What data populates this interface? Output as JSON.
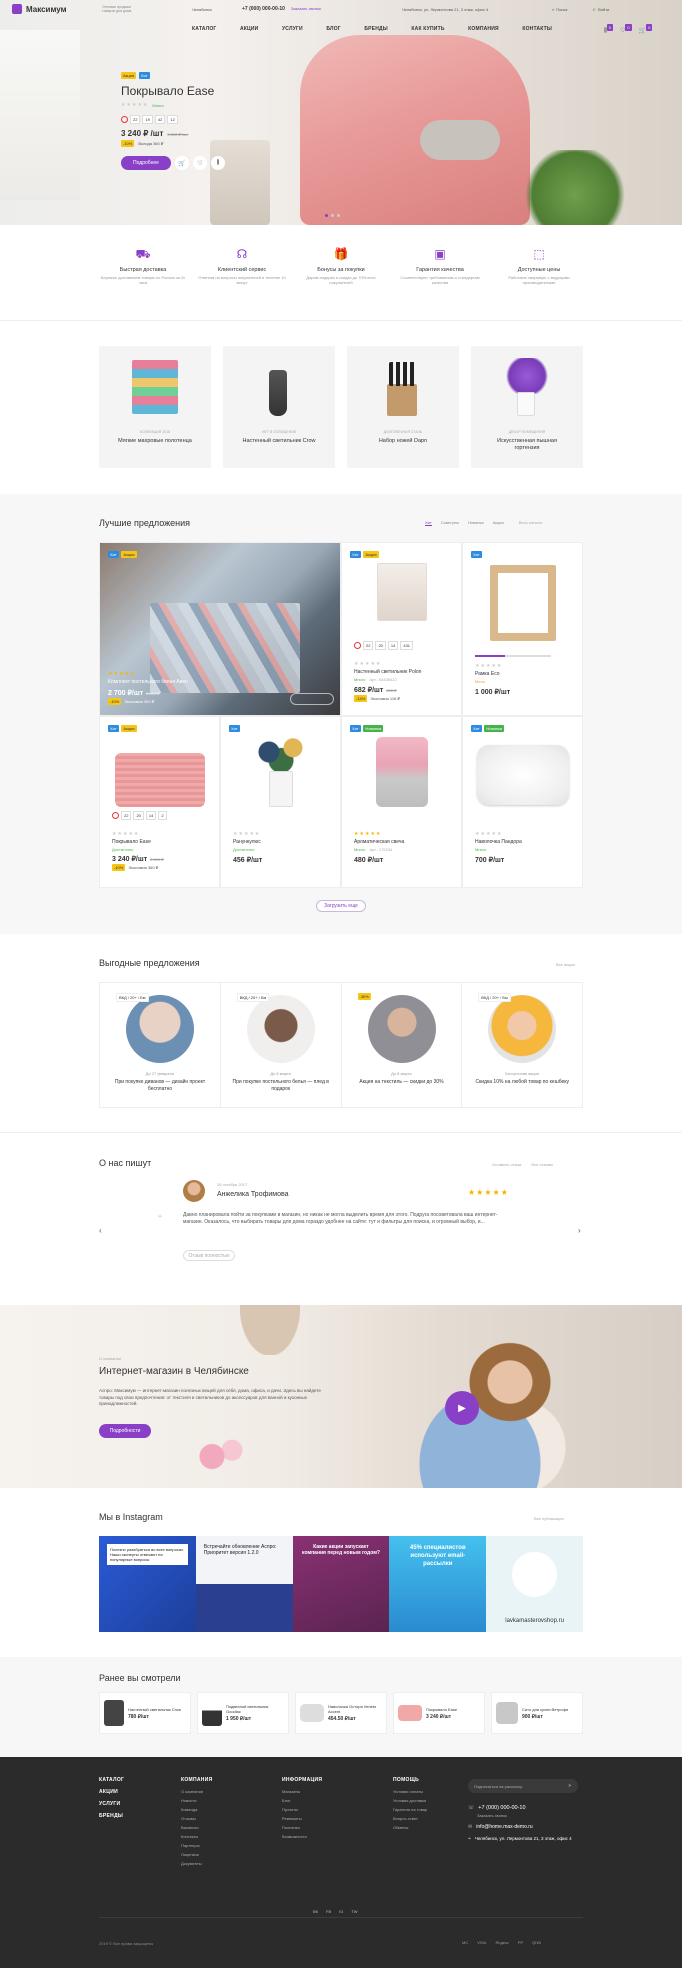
{
  "header": {
    "logo_text": "Максимум",
    "tagline_1": "Оптовая продажа",
    "tagline_2": "товаров для дома",
    "city": "Челябинск",
    "phone": "+7 (000) 000-00-10",
    "callback": "Заказать звонок",
    "address": "Челябинск, ул. Лермонтова 21, 3 этаж, офис 4",
    "search": "Поиск",
    "login": "Войти",
    "cart_count": "0",
    "fav_count": "0",
    "compare_count": "0",
    "nav": [
      "КАТАЛОГ",
      "АКЦИИ",
      "УСЛУГИ",
      "БЛОГ",
      "БРЕНДЫ",
      "КАК КУПИТЬ",
      "КОМПАНИЯ",
      "КОНТАКТЫ"
    ]
  },
  "hero": {
    "badges": [
      "Акция",
      "Хит"
    ],
    "title": "Покрывало Ease",
    "stock": "Много",
    "timer": [
      "22",
      "19",
      "42",
      "12"
    ],
    "price": "3 240 ₽ /шт",
    "old_price": "3 600 ₽ /шт",
    "discount": "-10%",
    "economy": "Выгода 360 ₽",
    "button": "Подробнее"
  },
  "benefits": [
    {
      "icon": "truck-icon",
      "title": "Быстрая доставка",
      "text": "Бережно доставляем товары по России за 2х часа"
    },
    {
      "icon": "headset-icon",
      "title": "Клиентский сервис",
      "text": "Ответим на вопросы покупателей в течение 10 минут"
    },
    {
      "icon": "gift-icon",
      "title": "Бонусы за покупки",
      "text": "Дарим подарки и скидки до 70% всех покупателей"
    },
    {
      "icon": "certificate-icon",
      "title": "Гарантия качества",
      "text": "Соответствуют требованиям и стандартам качества"
    },
    {
      "icon": "price-icon",
      "title": "Доступные цены",
      "text": "Работаем напрямую с ведущими производителями"
    }
  ],
  "categories": [
    {
      "caption": "Коллекция 2018",
      "title": "Мягкие махровые полотенца"
    },
    {
      "caption": "Нет в освещение",
      "title": "Настенный светильник Crow"
    },
    {
      "caption": "Долговечная сталь",
      "title": "Набор ножей Dapn"
    },
    {
      "caption": "Декор помещения",
      "title": "Искусственная пышная гортензия"
    }
  ],
  "best": {
    "title": "Лучшие предложения",
    "tabs": [
      "Хит",
      "Советуем",
      "Новинка",
      "Акция"
    ],
    "all_link": "Весь каталог",
    "load_more": "Загрузить еще",
    "products": [
      {
        "badges": [
          "Хит",
          "Акция"
        ],
        "name": "Комплект постельного белья Авен",
        "price": "2 700 ₽/шт",
        "old": "3 000 ₽",
        "discount": "-10%",
        "economy": "Экономия 300 ₽"
      },
      {
        "badges": [
          "Хит",
          "Акция"
        ],
        "name": "Настенный светильник Polon",
        "stock": "Много",
        "art": "Арт.: 54436422",
        "timer": [
          "22",
          "20",
          "14",
          "431"
        ],
        "price": "682 ₽/шт",
        "old": "800 ₽",
        "discount": "-14%",
        "economy": "Экономия 118 ₽"
      },
      {
        "badges": [
          "Хит"
        ],
        "name": "Рамка Eco",
        "stock": "Мало",
        "price": "1 000 ₽/шт"
      },
      {
        "badges": [
          "Хит",
          "Акция"
        ],
        "name": "Покрывало Ease",
        "stock": "Достаточно",
        "timer": [
          "22",
          "20",
          "14",
          "2"
        ],
        "price": "3 240 ₽/шт",
        "old": "3 600 ₽",
        "discount": "-10%",
        "economy": "Экономия 360 ₽"
      },
      {
        "badges": [
          "Хит"
        ],
        "name": "Ранункулюс",
        "stock": "Достаточно",
        "price": "456 ₽/шт"
      },
      {
        "badges": [
          "Хит",
          "Новинка"
        ],
        "name": "Ароматическая свеча",
        "stock": "Много",
        "art": "Арт.: 175234",
        "price": "480 ₽/шт"
      },
      {
        "badges": [
          "Хит",
          "Новинка"
        ],
        "name": "Наволочка Пандора",
        "stock": "Много",
        "price": "700 ₽/шт"
      }
    ]
  },
  "promos": {
    "title": "Выгодные предложения",
    "all_link": "Все акции",
    "items": [
      {
        "tag": "ВКД / 20+ / Бм",
        "date": "До 27 февраля",
        "text": "При покупке диванов — дизайн проект бесплатно"
      },
      {
        "tag": "ВКД / 20+ / Бм",
        "date": "До 8 марта",
        "text": "При покупке постельного белья — плед в подарок"
      },
      {
        "tag": "-30%",
        "date": "До 8 марта",
        "text": "Акция на текстиль — скидки до 30%"
      },
      {
        "tag": "ВКД / 20+ / Бм",
        "date": "Бессрочная акция",
        "text": "Скидка 10% на любой товар по кешбеку"
      }
    ]
  },
  "reviews": {
    "title": "О нас пишут",
    "leave": "Оставить отзыв",
    "all_link": "Все отзывы",
    "date": "26 октября 2017",
    "author": "Анжелика Трофимова",
    "text": "Давно планировала пойти за покупками в магазин, но никак не могла выделить время для этого. Подруга посоветовала ваш интернет-магазин. Оказалось, что выбирать товары для дома гораздо удобнее на сайте: тут и фильтры для поиска, и огромный выбор, и...",
    "more": "Отзыв полностью"
  },
  "about": {
    "label": "О компании",
    "title": "Интернет-магазин в Челябинске",
    "text": "Аспро: Максимум — интернет-магазин полезных вещей для себя, дома, офиса, и дачи. Здесь вы найдете товары под свои предпочтения: от текстиля и светильников до аксессуаров для ванной и кухонных принадлежностей.",
    "button": "Подробности"
  },
  "instagram": {
    "title": "Мы в Instagram",
    "all_link": "Все публикации",
    "posts": [
      {
        "text": "Полезно разобраться во всех вопросах. Наши эксперты отвечают на популярные вопросы",
        "color": "#2a5bd7"
      },
      {
        "text": "Встречайте обновление Аспро: Приоритет версия 1.2.0",
        "color": "#2a3f8f"
      },
      {
        "text": "Какие акции запускает компания перед новым годом?",
        "color": "#7a2e6e"
      },
      {
        "text": "45% специалистов используют email-рассылки",
        "color": "#3bb4e8"
      },
      {
        "text": "lavkamasterovshop.ru",
        "color": "#e9f4f7"
      }
    ]
  },
  "viewed": {
    "title": "Ранее вы смотрели",
    "items": [
      {
        "name": "Настенный светильник Crow",
        "price": "780 ₽/шт"
      },
      {
        "name": "Подвесной светильник Goodlac",
        "price": "1 950 ₽/шт"
      },
      {
        "name": "Наволочка Остора Veneto Accent",
        "price": "454.50 ₽/шт"
      },
      {
        "name": "Покрывало Ease",
        "price": "3 240 ₽/шт"
      },
      {
        "name": "Сито для кухни Ветрофи",
        "price": "900 ₽/шт"
      }
    ]
  },
  "footer": {
    "col1": [
      "КАТАЛОГ",
      "АКЦИИ",
      "УСЛУГИ",
      "БРЕНДЫ"
    ],
    "col2_title": "КОМПАНИЯ",
    "col2": [
      "О компании",
      "Новости",
      "Команда",
      "Отзывы",
      "Вакансии",
      "Контакты",
      "Партнеры",
      "Лицензии",
      "Документы"
    ],
    "col3_title": "ИНФОРМАЦИЯ",
    "col3": [
      "Магазины",
      "Блог",
      "Проекты",
      "Реквизиты",
      "Политика",
      "Возможности"
    ],
    "col4_title": "ПОМОЩЬ",
    "col4": [
      "Условия оплаты",
      "Условия доставки",
      "Гарантия на товар",
      "Вопрос-ответ",
      "Обмены"
    ],
    "subscribe": "Подписаться на рассылку",
    "phone": "+7 (000) 000-00-10",
    "callback": "Заказать звонок",
    "email": "info@home.max-demo.ru",
    "address": "Челябинск, ул. Лермонтова 21, 3 этаж, офис 4",
    "copyright": "2019 © Все права защищены",
    "social": [
      "ВК",
      "FB",
      "IG",
      "TW"
    ],
    "payments": [
      "MC",
      "VISA",
      "Яндекс",
      "PP",
      "QIWI"
    ]
  }
}
